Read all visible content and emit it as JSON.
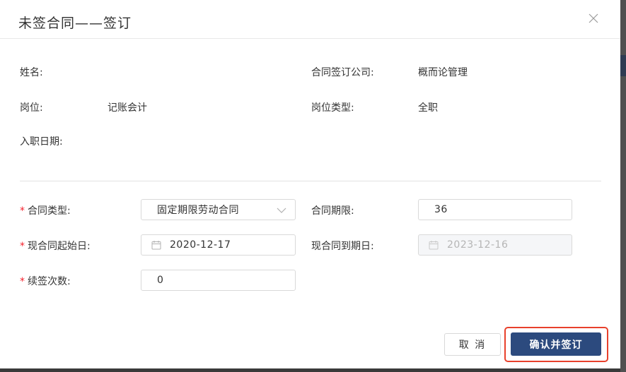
{
  "dialog": {
    "title": "未签合同——签订"
  },
  "info": {
    "name_label": "姓名:",
    "name_value": "",
    "company_label": "合同签订公司:",
    "company_value": "概而论管理",
    "position_label": "岗位:",
    "position_value": "记账会计",
    "position_type_label": "岗位类型:",
    "position_type_value": "全职",
    "entry_date_label": "入职日期:",
    "entry_date_value": ""
  },
  "form": {
    "required_mark": "*",
    "contract_type_label": "合同类型:",
    "contract_type_value": "固定期限劳动合同",
    "contract_term_label": "合同期限:",
    "contract_term_value": "36",
    "start_date_label": "现合同起始日:",
    "start_date_value": "2020-12-17",
    "end_date_label": "现合同到期日:",
    "end_date_value": "2023-12-16",
    "renew_count_label": "续签次数:",
    "renew_count_value": "0"
  },
  "footer": {
    "cancel_label": "取 消",
    "confirm_label": "确认并签订"
  },
  "colors": {
    "primary": "#2c4a7e",
    "required": "#f5222d",
    "highlight": "#e8412c"
  }
}
